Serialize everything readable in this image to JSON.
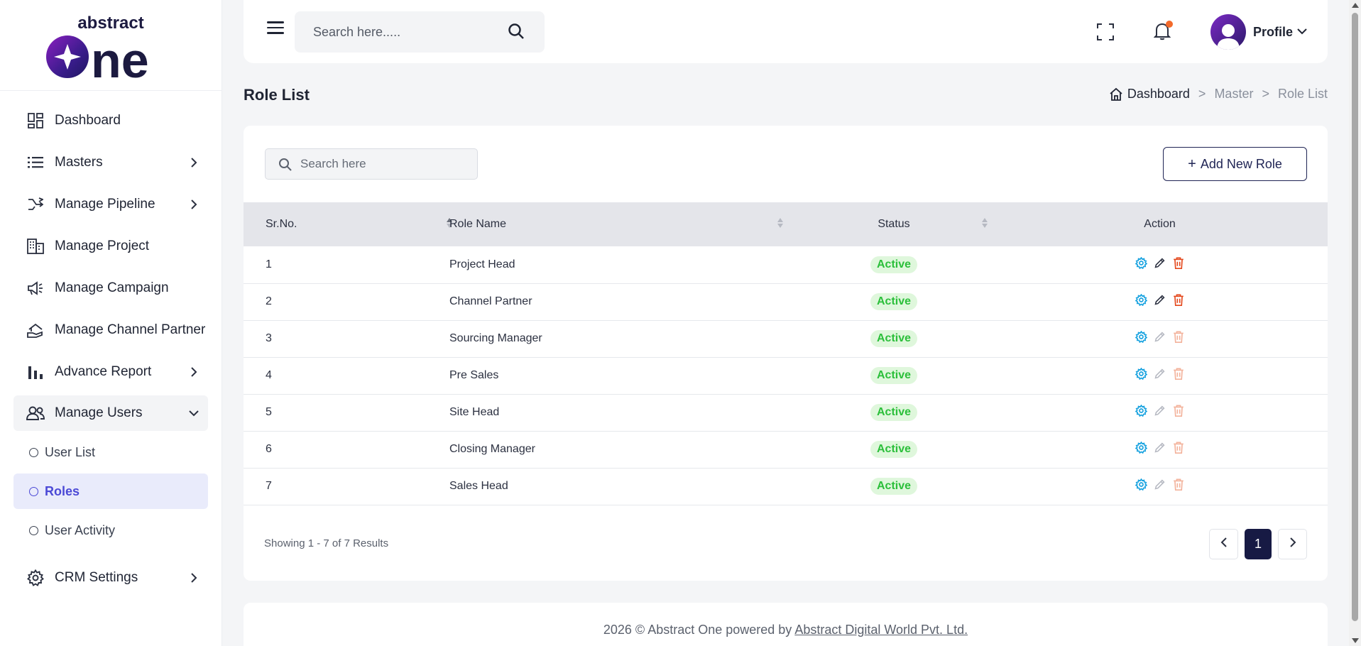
{
  "brand": {
    "logo_top": "abstract",
    "logo_main": "one"
  },
  "sidebar": {
    "items": [
      {
        "label": "Dashboard",
        "icon": "dashboard-icon",
        "has_chevron": false
      },
      {
        "label": "Masters",
        "icon": "list-icon",
        "has_chevron": true
      },
      {
        "label": "Manage Pipeline",
        "icon": "pipeline-icon",
        "has_chevron": true
      },
      {
        "label": "Manage Project",
        "icon": "building-icon",
        "has_chevron": false
      },
      {
        "label": "Manage Campaign",
        "icon": "megaphone-icon",
        "has_chevron": false
      },
      {
        "label": "Manage Channel Partner",
        "icon": "partner-icon",
        "has_chevron": false
      },
      {
        "label": "Advance Report",
        "icon": "bar-chart-icon",
        "has_chevron": true
      },
      {
        "label": "Manage Users",
        "icon": "users-icon",
        "has_chevron": true,
        "expanded": true
      }
    ],
    "sub_items": [
      {
        "label": "User List",
        "active": false
      },
      {
        "label": "Roles",
        "active": true
      },
      {
        "label": "User Activity",
        "active": false
      }
    ],
    "bottom_item": {
      "label": "CRM Settings",
      "icon": "gear-icon",
      "has_chevron": true
    }
  },
  "header": {
    "search_placeholder": "Search here.....",
    "profile_label": "Profile"
  },
  "page": {
    "title": "Role List",
    "breadcrumb": [
      "Dashboard",
      "Master",
      "Role List"
    ],
    "breadcrumb_sep": ">"
  },
  "card": {
    "search_placeholder": "Search here",
    "add_button": "Add New Role",
    "add_button_prefix": "+",
    "columns": [
      "Sr.No.",
      "Role Name",
      "Status",
      "Action"
    ],
    "rows": [
      {
        "sr": "1",
        "name": "Project Head",
        "status": "Active",
        "actions_enabled": true
      },
      {
        "sr": "2",
        "name": "Channel Partner",
        "status": "Active",
        "actions_enabled": true
      },
      {
        "sr": "3",
        "name": "Sourcing Manager",
        "status": "Active",
        "actions_enabled": false
      },
      {
        "sr": "4",
        "name": "Pre Sales",
        "status": "Active",
        "actions_enabled": false
      },
      {
        "sr": "5",
        "name": "Site Head",
        "status": "Active",
        "actions_enabled": false
      },
      {
        "sr": "6",
        "name": "Closing Manager",
        "status": "Active",
        "actions_enabled": false
      },
      {
        "sr": "7",
        "name": "Sales Head",
        "status": "Active",
        "actions_enabled": false
      }
    ],
    "showing": "Showing 1 - 7 of 7 Results",
    "current_page": "1"
  },
  "footer": {
    "text": "2026 © Abstract One powered by",
    "link": "Abstract Digital World Pvt. Ltd."
  },
  "colors": {
    "accent": "#4b49d6",
    "navy": "#171a44",
    "status_green": "#2bbf3a",
    "delete_red": "#e4471b",
    "settings_blue": "#1aa3e0",
    "notification": "#f36a2b"
  }
}
